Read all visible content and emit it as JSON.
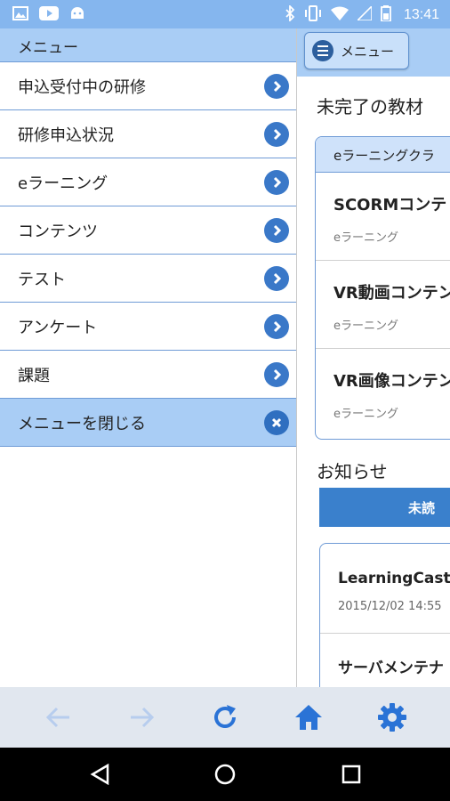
{
  "status_bar": {
    "time": "13:41",
    "left_icons": [
      "image-icon",
      "youtube-icon",
      "android-icon"
    ],
    "right_icons": [
      "bluetooth-icon",
      "vibrate-icon",
      "wifi-icon",
      "signal-icon",
      "battery-icon"
    ]
  },
  "side_menu": {
    "header": "メニュー",
    "items": [
      {
        "label": "申込受付中の研修",
        "icon": "chevron-right-icon"
      },
      {
        "label": "研修申込状況",
        "icon": "chevron-right-icon"
      },
      {
        "label": "eラーニング",
        "icon": "chevron-right-icon"
      },
      {
        "label": "コンテンツ",
        "icon": "chevron-right-icon"
      },
      {
        "label": "テスト",
        "icon": "chevron-right-icon"
      },
      {
        "label": "アンケート",
        "icon": "chevron-right-icon"
      },
      {
        "label": "課題",
        "icon": "chevron-right-icon"
      }
    ],
    "close_label": "メニューを閉じる"
  },
  "content": {
    "menu_button_label": "メニュー",
    "incomplete_title": "未完了の教材",
    "panel_header": "eラーニングクラ",
    "materials": [
      {
        "title": "SCORMコンテ",
        "type": "eラーニング"
      },
      {
        "title": "VR動画コンテン",
        "type": "eラーニング"
      },
      {
        "title": "VR画像コンテン",
        "type": "eラーニング"
      }
    ],
    "news_title": "お知らせ",
    "unread_tab": "未読",
    "news": [
      {
        "title": "LearningCastを",
        "date": "2015/12/02 14:55"
      },
      {
        "title": "サーバメンテナ",
        "date": ""
      }
    ]
  },
  "toolbar": {
    "icons": [
      "back-arrow-icon",
      "forward-arrow-icon",
      "reload-icon",
      "home-icon",
      "settings-icon"
    ]
  },
  "colors": {
    "accent": "#3a78c8",
    "header_bg": "#a9cdf5",
    "status_bar": "#85b6ee",
    "toolbar_bg": "#e1e7ef"
  }
}
